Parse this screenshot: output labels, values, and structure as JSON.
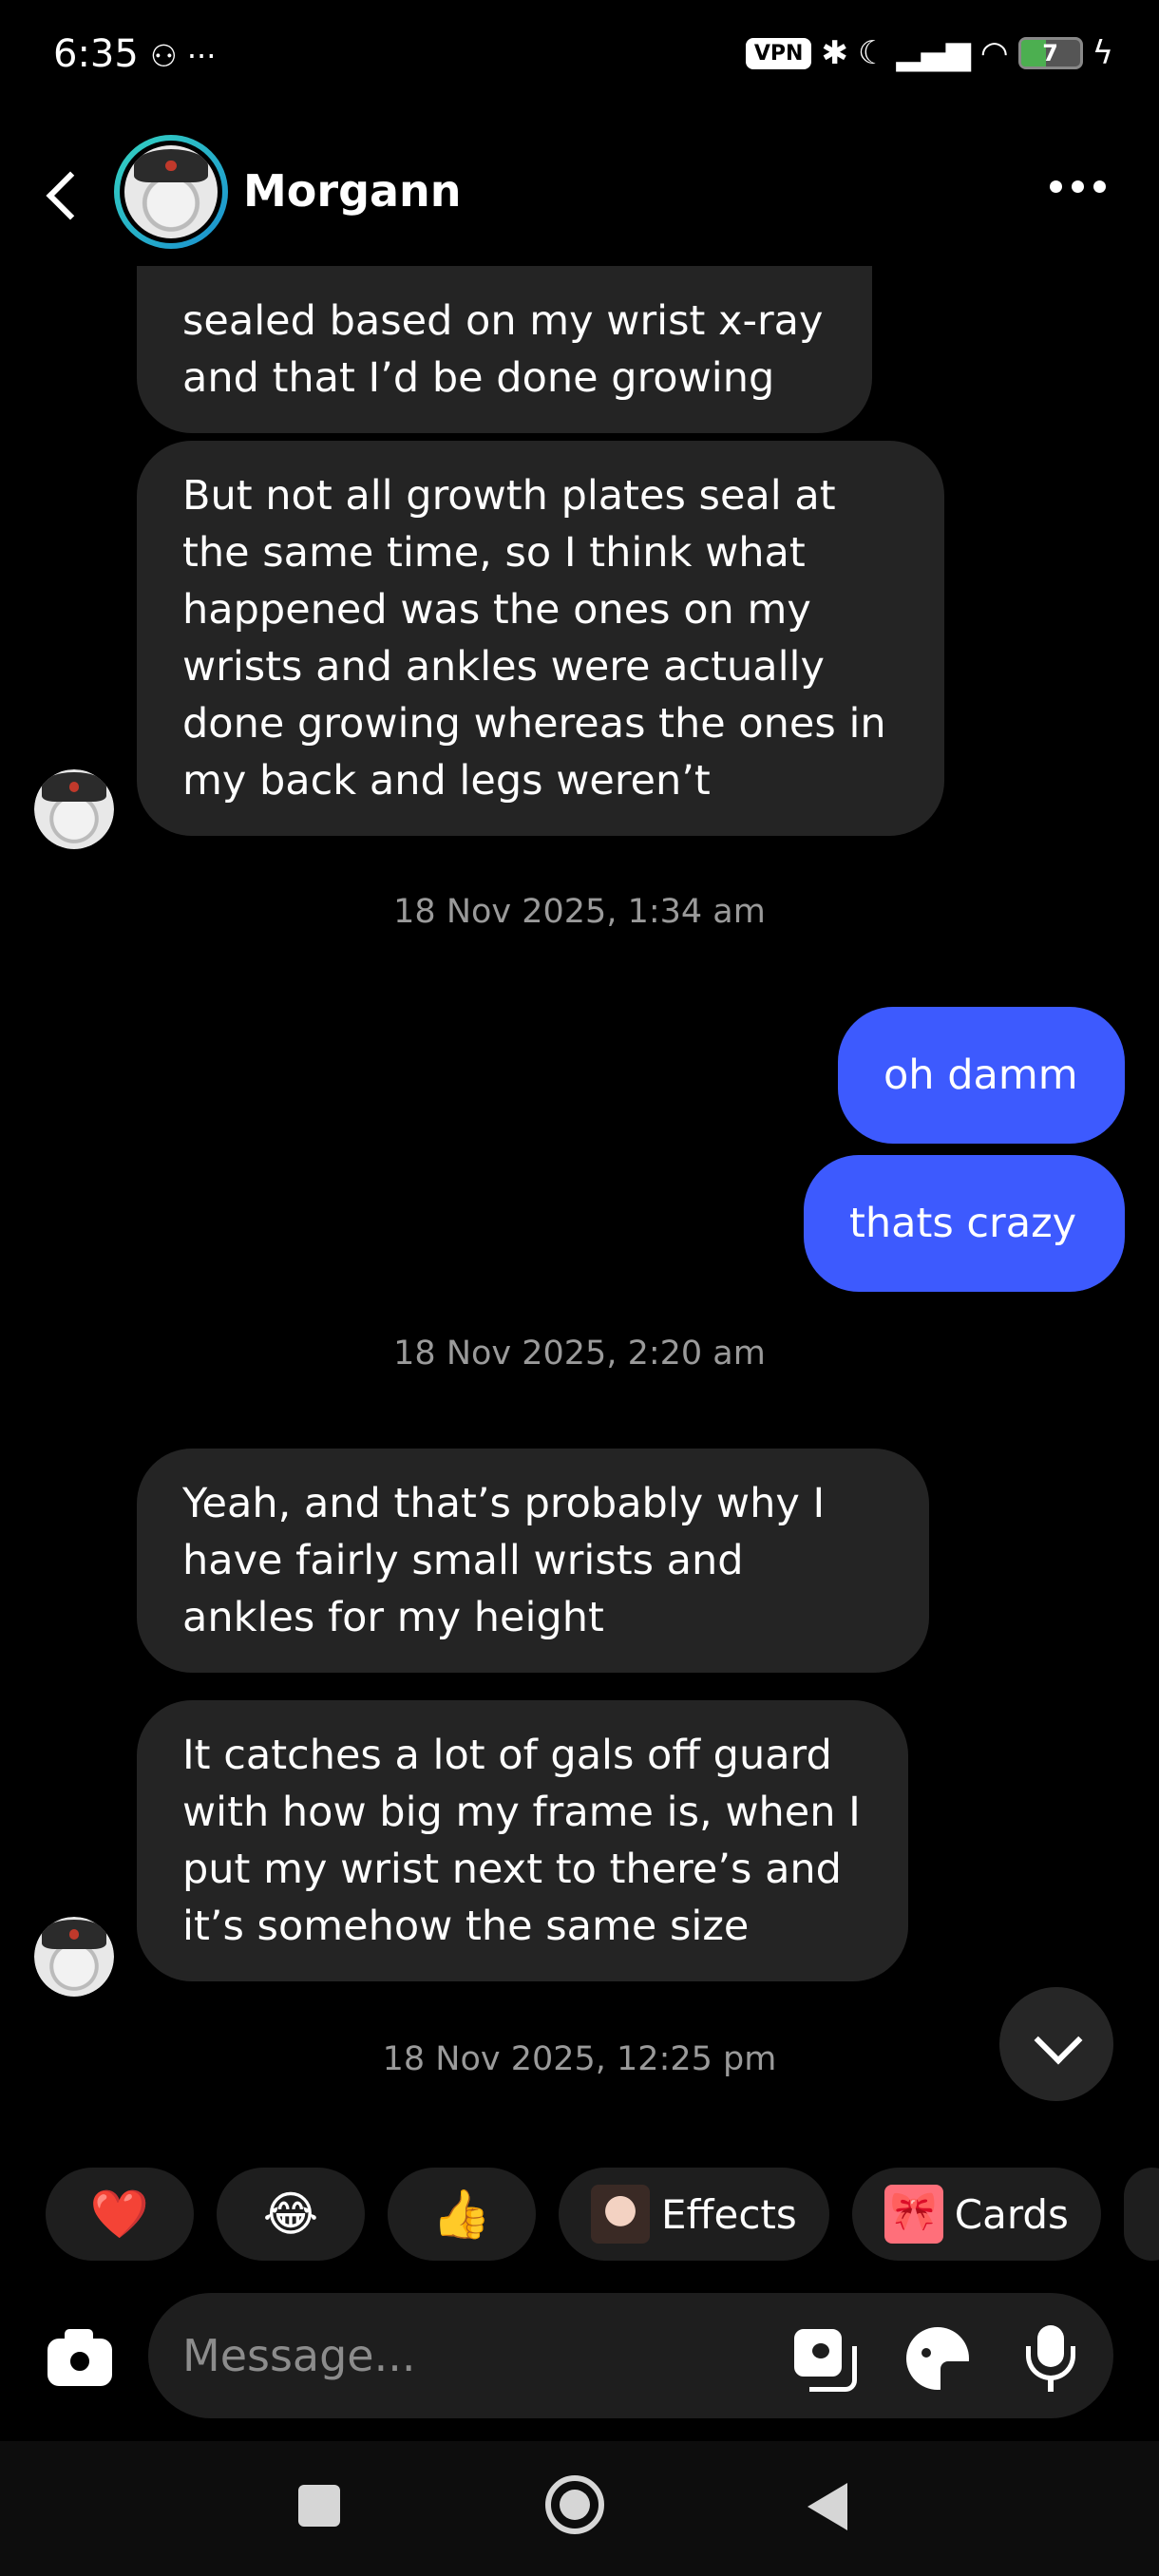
{
  "status_bar": {
    "time": "6:35",
    "left_icons": "⚇ ···",
    "vpn_label": "VPN",
    "battery_level": "7",
    "battery_fraction": 0.07
  },
  "header": {
    "contact_name": "Morgann"
  },
  "messages": [
    {
      "from": "them",
      "text": "sealed based on my wrist x-ray and that I’d be done growing"
    },
    {
      "from": "them",
      "text": "But not all growth plates seal at the same time, so I think what happened was the ones on my wrists and ankles were actually done growing whereas the ones in my back and legs weren’t"
    },
    {
      "type": "timestamp",
      "text": "18 Nov 2025, 1:34 am"
    },
    {
      "from": "me",
      "text": "oh damm"
    },
    {
      "from": "me",
      "text": "thats crazy"
    },
    {
      "type": "timestamp",
      "text": "18 Nov 2025, 2:20 am"
    },
    {
      "from": "them",
      "text": "Yeah, and that’s probably why I have fairly small wrists and ankles for my height"
    },
    {
      "from": "them",
      "text": "It catches a lot of gals off guard with how big my frame is, when I put my wrist next to there’s and it’s somehow the same size"
    },
    {
      "type": "timestamp",
      "text": "18 Nov 2025, 12:25 pm"
    }
  ],
  "reactions": {
    "heart": "❤️",
    "laugh": "😂",
    "thumbs_up": "👍",
    "effects_label": "Effects",
    "cards_label": "Cards"
  },
  "composer": {
    "placeholder": "Message..."
  },
  "colors": {
    "background": "#000000",
    "their_bubble": "#242424",
    "my_bubble": "#3d5afe",
    "timestamp": "#9a9a9a"
  }
}
